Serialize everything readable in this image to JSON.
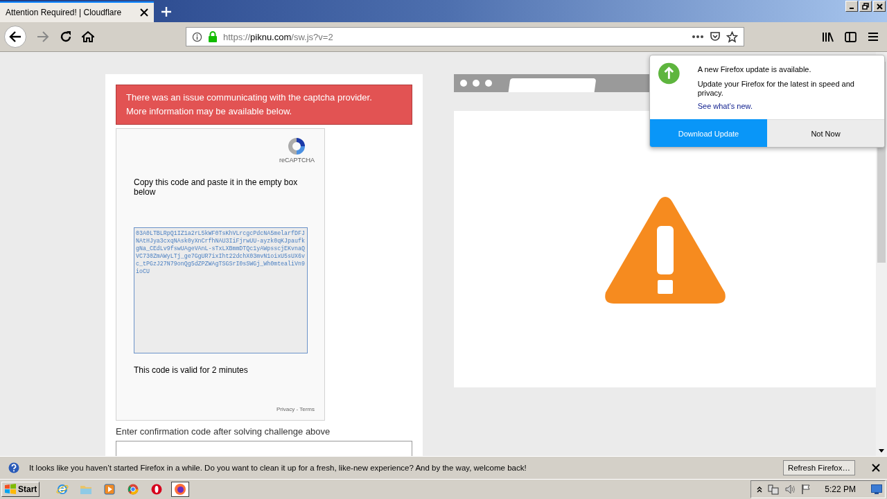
{
  "tab": {
    "title": "Attention Required! | Cloudflare",
    "selected": true
  },
  "address": {
    "scheme": "https://",
    "host": "piknu.com",
    "path": "/sw.js?v=2"
  },
  "page": {
    "alert": "There was an issue communicating with the captcha provider. More information may be available below.",
    "recaptcha_label": "reCAPTCHA",
    "instruction": "Copy this code and paste it in the empty box below",
    "code": "03A0LTBLRpQ1IZ1a2rL5kWF0TsKhVLrcgcPdcNA5melarfDFJNAtHJya3cxqNAsk0yXnCrfhNAU3IiFjrwUU-ayzk0qKJpaufkgNa_CEdLv9fswUAgeVAnL-sTxLXBmmDTQc1yAWpsscjEKvnaQVC730ZmAWyLTj_ge7GgUR7ixIht22dchX03mvN1oixU5sUX6vc_tPGzJ27N79onQg5dZPZWAgTSGSrI0sSWGj_Wh0mtealiVn9ioCU",
    "validity": "This code is valid for 2 minutes",
    "privacy": "Privacy",
    "separator": " - ",
    "terms": "Terms",
    "confirm_label": "Enter confirmation code after solving challenge above"
  },
  "update_panel": {
    "title": "A new Firefox update is available.",
    "body": "Update your Firefox for the latest in speed and privacy.",
    "link": "See what’s new.",
    "buttons": [
      {
        "label": "Download Update",
        "kind": "primary"
      },
      {
        "label": "Not Now",
        "kind": "secondary"
      }
    ]
  },
  "notification": {
    "text": "It looks like you haven’t started Firefox in a while. Do you want to clean it up for a fresh, like-new experience? And by the way, welcome back!",
    "button": "Refresh Firefox…"
  },
  "taskbar": {
    "start": "Start",
    "apps": [
      {
        "kind": "ie",
        "selected": false
      },
      {
        "kind": "explorer",
        "selected": false
      },
      {
        "kind": "media",
        "selected": false
      },
      {
        "kind": "chrome",
        "selected": false
      },
      {
        "kind": "opera",
        "selected": false
      },
      {
        "kind": "firefox",
        "selected": true
      }
    ],
    "clock": "5:22 PM"
  }
}
